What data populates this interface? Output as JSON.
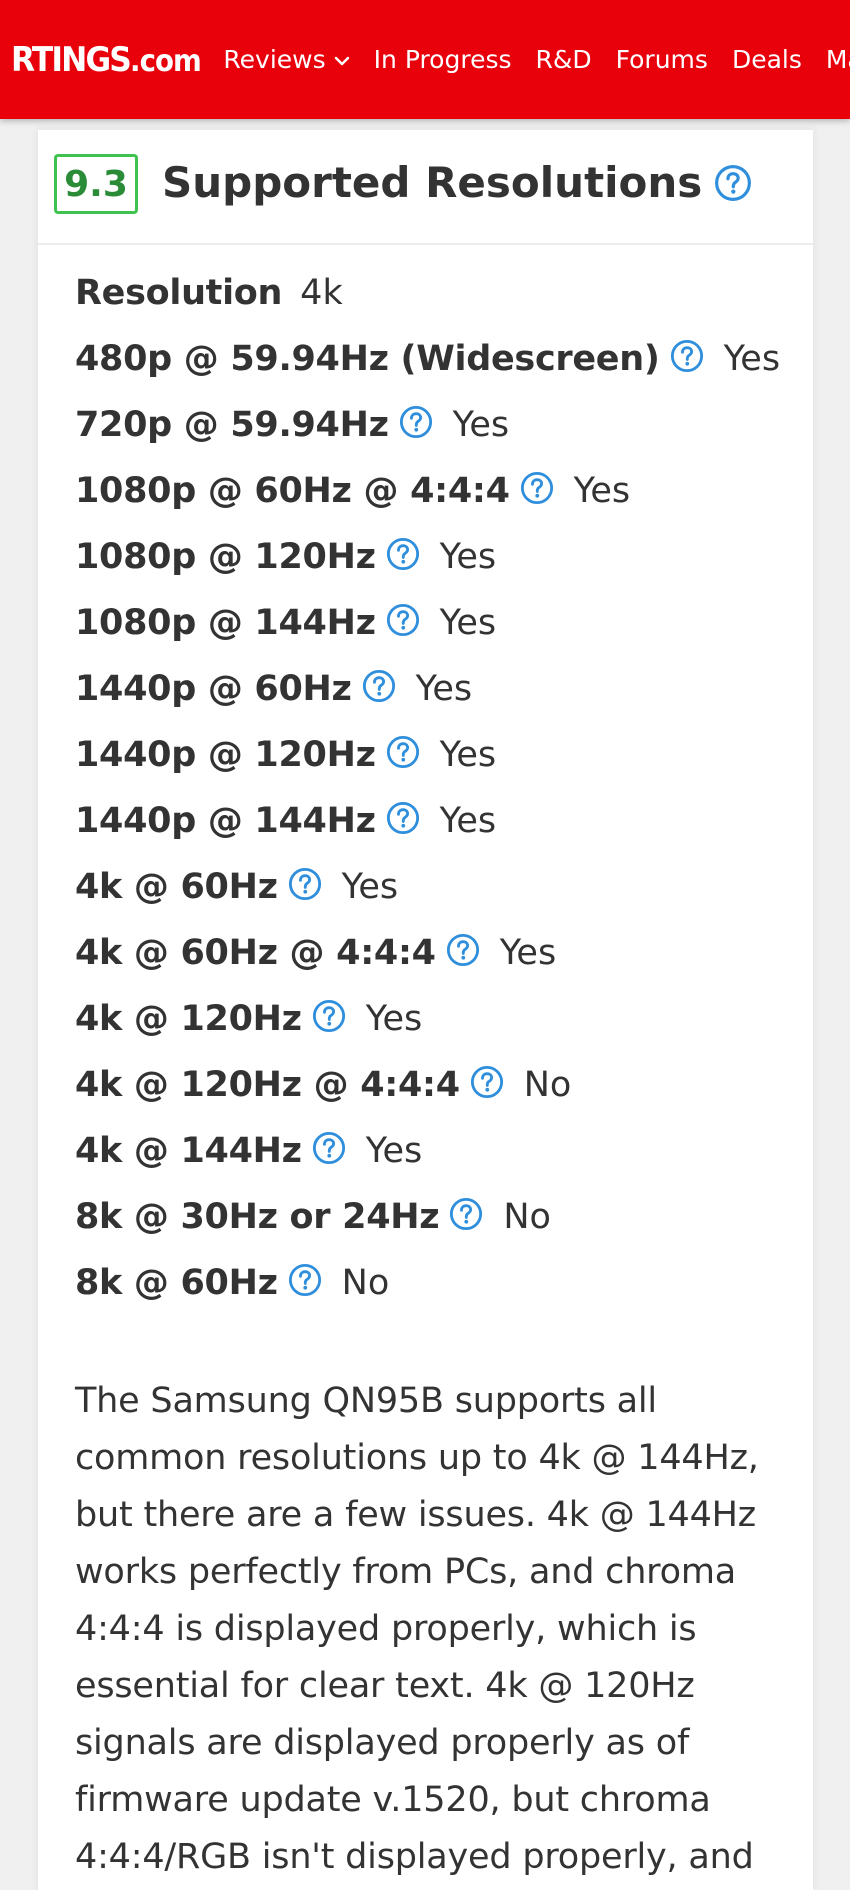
{
  "nav": {
    "logo_main": "RTINGS",
    "logo_suffix": ".com",
    "items": [
      {
        "label": "Reviews"
      },
      {
        "label": "In Progress"
      },
      {
        "label": "R&D"
      },
      {
        "label": "Forums"
      },
      {
        "label": "Deals"
      },
      {
        "label": "Mail"
      }
    ]
  },
  "section": {
    "score": "9.3",
    "title": "Supported Resolutions",
    "resolution_label": "Resolution",
    "resolution_value": "4k",
    "rows": [
      {
        "label": "480p @ 59.94Hz (Widescreen)",
        "value": "Yes"
      },
      {
        "label": "720p @ 59.94Hz",
        "value": "Yes"
      },
      {
        "label": "1080p @ 60Hz @ 4:4:4",
        "value": "Yes"
      },
      {
        "label": "1080p @ 120Hz",
        "value": "Yes"
      },
      {
        "label": "1080p @ 144Hz",
        "value": "Yes"
      },
      {
        "label": "1440p @ 60Hz",
        "value": "Yes"
      },
      {
        "label": "1440p @ 120Hz",
        "value": "Yes"
      },
      {
        "label": "1440p @ 144Hz",
        "value": "Yes"
      },
      {
        "label": "4k @ 60Hz",
        "value": "Yes"
      },
      {
        "label": "4k @ 60Hz @ 4:4:4",
        "value": "Yes"
      },
      {
        "label": "4k @ 120Hz",
        "value": "Yes"
      },
      {
        "label": "4k @ 120Hz @ 4:4:4",
        "value": "No"
      },
      {
        "label": "4k @ 144Hz",
        "value": "Yes"
      },
      {
        "label": "8k @ 30Hz or 24Hz",
        "value": "No"
      },
      {
        "label": "8k @ 60Hz",
        "value": "No"
      }
    ],
    "description": "The Samsung QN95B supports all common resolutions up to 4k @ 144Hz, but there are a few issues. 4k @ 144Hz works perfectly from PCs, and chroma 4:4:4 is displayed properly, which is essential for clear text. 4k @ 120Hz signals are displayed properly as of firmware update v.1520, but chroma 4:4:4/RGB isn't displayed properly, and"
  },
  "colors": {
    "brand_red": "#e8000b",
    "score_green": "#3fc24f",
    "help_blue": "#2f8fdc"
  },
  "icons": {
    "nav_dropdown": "chevron-down-icon",
    "help": "question-circle-icon"
  }
}
